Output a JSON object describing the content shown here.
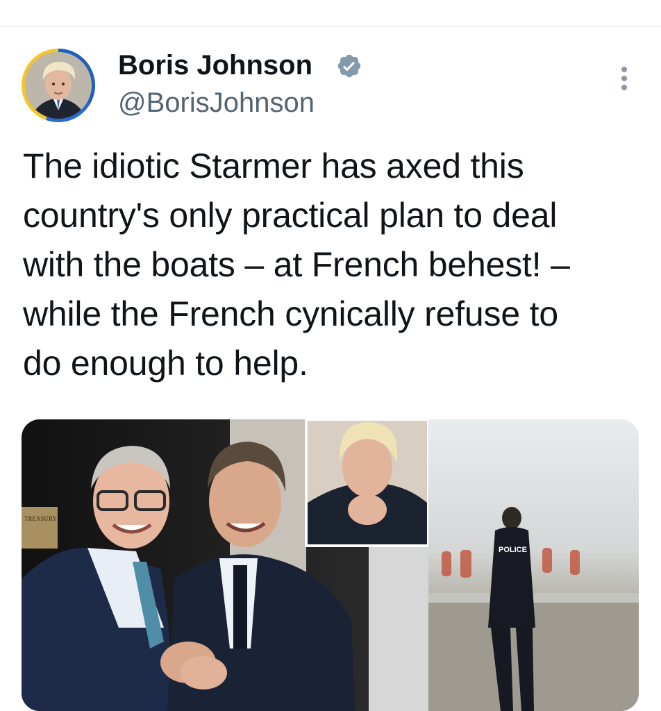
{
  "header": {
    "display_name": "Boris Johnson",
    "handle": "@BorisJohnson",
    "verified_icon": "verified-badge-icon",
    "more_icon": "more-options-icon"
  },
  "tweet": {
    "text": "The idiotic Starmer has axed this\ncountry's only practical plan to deal\nwith the boats – at French behest! –\nwhile the French cynically refuse to\ndo enough to help."
  },
  "media": {
    "sign_text": "TREASURY",
    "police_label": "POLICE"
  },
  "colors": {
    "text": "#0f1419",
    "secondary": "#536471",
    "verified": "#829aab",
    "divider": "#e6e9ec"
  }
}
